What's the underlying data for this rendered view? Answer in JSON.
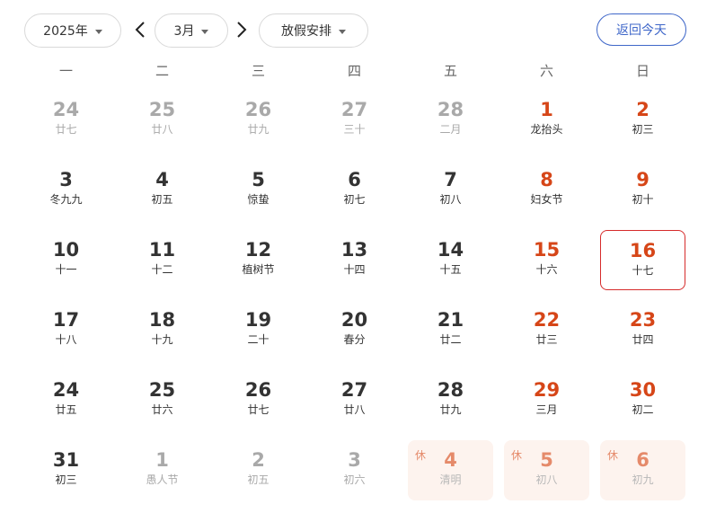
{
  "toolbar": {
    "year_label": "2025年",
    "month_label": "3月",
    "holiday_label": "放假安排",
    "today_label": "返回今天"
  },
  "weekdays": [
    "一",
    "二",
    "三",
    "四",
    "五",
    "六",
    "日"
  ],
  "holiday_badge": "休",
  "weeks": [
    [
      {
        "day": "24",
        "lunar": "廿七",
        "state": "other"
      },
      {
        "day": "25",
        "lunar": "廿八",
        "state": "other"
      },
      {
        "day": "26",
        "lunar": "廿九",
        "state": "other"
      },
      {
        "day": "27",
        "lunar": "三十",
        "state": "other"
      },
      {
        "day": "28",
        "lunar": "二月",
        "state": "other"
      },
      {
        "day": "1",
        "lunar": "龙抬头",
        "state": "weekend"
      },
      {
        "day": "2",
        "lunar": "初三",
        "state": "weekend"
      }
    ],
    [
      {
        "day": "3",
        "lunar": "冬九九",
        "state": "normal"
      },
      {
        "day": "4",
        "lunar": "初五",
        "state": "normal"
      },
      {
        "day": "5",
        "lunar": "惊蛰",
        "state": "normal"
      },
      {
        "day": "6",
        "lunar": "初七",
        "state": "normal"
      },
      {
        "day": "7",
        "lunar": "初八",
        "state": "normal"
      },
      {
        "day": "8",
        "lunar": "妇女节",
        "state": "weekend"
      },
      {
        "day": "9",
        "lunar": "初十",
        "state": "weekend"
      }
    ],
    [
      {
        "day": "10",
        "lunar": "十一",
        "state": "normal"
      },
      {
        "day": "11",
        "lunar": "十二",
        "state": "normal"
      },
      {
        "day": "12",
        "lunar": "植树节",
        "state": "normal"
      },
      {
        "day": "13",
        "lunar": "十四",
        "state": "normal"
      },
      {
        "day": "14",
        "lunar": "十五",
        "state": "normal"
      },
      {
        "day": "15",
        "lunar": "十六",
        "state": "weekend"
      },
      {
        "day": "16",
        "lunar": "十七",
        "state": "today"
      }
    ],
    [
      {
        "day": "17",
        "lunar": "十八",
        "state": "normal"
      },
      {
        "day": "18",
        "lunar": "十九",
        "state": "normal"
      },
      {
        "day": "19",
        "lunar": "二十",
        "state": "normal"
      },
      {
        "day": "20",
        "lunar": "春分",
        "state": "normal"
      },
      {
        "day": "21",
        "lunar": "廿二",
        "state": "normal"
      },
      {
        "day": "22",
        "lunar": "廿三",
        "state": "weekend"
      },
      {
        "day": "23",
        "lunar": "廿四",
        "state": "weekend"
      }
    ],
    [
      {
        "day": "24",
        "lunar": "廿五",
        "state": "normal"
      },
      {
        "day": "25",
        "lunar": "廿六",
        "state": "normal"
      },
      {
        "day": "26",
        "lunar": "廿七",
        "state": "normal"
      },
      {
        "day": "27",
        "lunar": "廿八",
        "state": "normal"
      },
      {
        "day": "28",
        "lunar": "廿九",
        "state": "normal"
      },
      {
        "day": "29",
        "lunar": "三月",
        "state": "weekend"
      },
      {
        "day": "30",
        "lunar": "初二",
        "state": "weekend"
      }
    ],
    [
      {
        "day": "31",
        "lunar": "初三",
        "state": "normal"
      },
      {
        "day": "1",
        "lunar": "愚人节",
        "state": "other"
      },
      {
        "day": "2",
        "lunar": "初五",
        "state": "other"
      },
      {
        "day": "3",
        "lunar": "初六",
        "state": "other"
      },
      {
        "day": "4",
        "lunar": "清明",
        "state": "holiday"
      },
      {
        "day": "5",
        "lunar": "初八",
        "state": "holiday"
      },
      {
        "day": "6",
        "lunar": "初九",
        "state": "holiday"
      }
    ]
  ],
  "colors": {
    "accent_blue": "#3f67c9",
    "weekend_red": "#d64618",
    "today_border": "#d62b2b",
    "holiday_bg": "#fdf3ee",
    "muted_gray": "#a9a9a9"
  }
}
